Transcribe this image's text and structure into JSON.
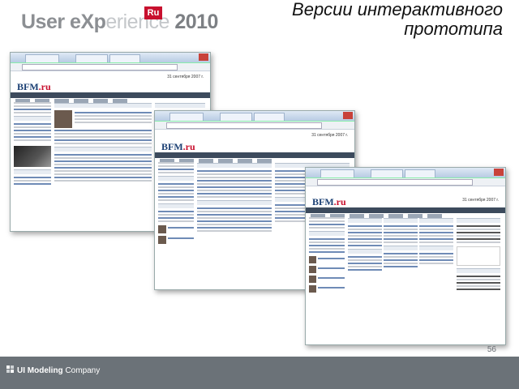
{
  "header": {
    "logo": {
      "part1": "User eXp",
      "part2": "erience",
      "year": " 2010",
      "badge": "Ru"
    },
    "title_line1": "Версии интерактивного",
    "title_line2": "прототипа"
  },
  "screenshots": [
    {
      "brand": "BFM",
      "brand_suffix": ".ru",
      "date": "31 сентября 2007 г."
    },
    {
      "brand": "BFM",
      "brand_suffix": ".ru",
      "date": "31 сентября 2007 г."
    },
    {
      "brand": "BFM",
      "brand_suffix": ".ru",
      "date": "31 сентября 2007 г."
    }
  ],
  "footer": {
    "company_bold": "UI Modeling",
    "company_light": " Company",
    "page_number": "56"
  },
  "colors": {
    "footer_bg": "#6b7278",
    "badge_red": "#c8102e",
    "brand_blue": "#1a3f73"
  }
}
